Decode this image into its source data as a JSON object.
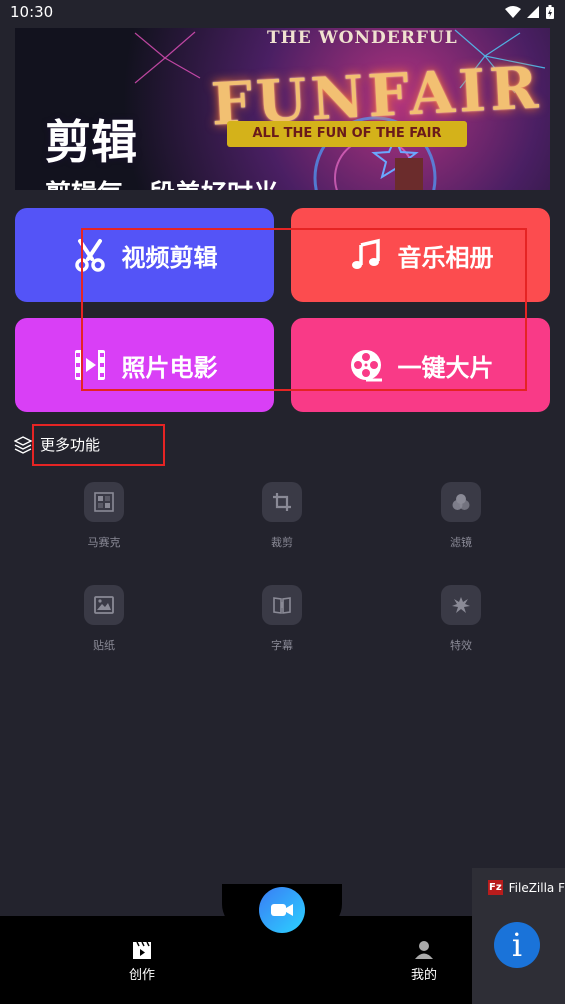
{
  "status_bar": {
    "time": "10:30"
  },
  "banner": {
    "title": "剪辑",
    "subtitle": "剪辑每一段美好时光",
    "fair_top": "THE WONDERFUL",
    "fair_main": "FUNFAIR",
    "fair_ribbon": "ALL THE FUN OF THE FAIR"
  },
  "feature_cards": [
    {
      "label": "视频剪辑",
      "icon": "scissors-icon",
      "color": "#5454f7"
    },
    {
      "label": "音乐相册",
      "icon": "music-note-icon",
      "color": "#fc4c4f"
    },
    {
      "label": "照片电影",
      "icon": "film-strip-icon",
      "color": "#d93ff6"
    },
    {
      "label": "一键大片",
      "icon": "film-reel-icon",
      "color": "#f93a87"
    }
  ],
  "more_section": {
    "title": "更多功能",
    "icon": "layers-icon"
  },
  "tools": [
    {
      "label": "马赛克",
      "icon": "mosaic-icon"
    },
    {
      "label": "裁剪",
      "icon": "crop-icon"
    },
    {
      "label": "滤镜",
      "icon": "filter-icon"
    },
    {
      "label": "贴纸",
      "icon": "sticker-icon"
    },
    {
      "label": "字幕",
      "icon": "subtitle-icon"
    },
    {
      "label": "特效",
      "icon": "effects-icon"
    }
  ],
  "bottom_nav": {
    "create_label": "创作",
    "mine_label": "我的",
    "record_icon": "video-camera-icon"
  },
  "notification": {
    "app_name": "FileZilla F",
    "logo_text": "Fz",
    "info_glyph": "i"
  },
  "colors": {
    "background": "#23232d",
    "highlight_box": "#e52424",
    "record_gradient_start": "#3a7cf5",
    "record_gradient_end": "#2bd2ff"
  }
}
